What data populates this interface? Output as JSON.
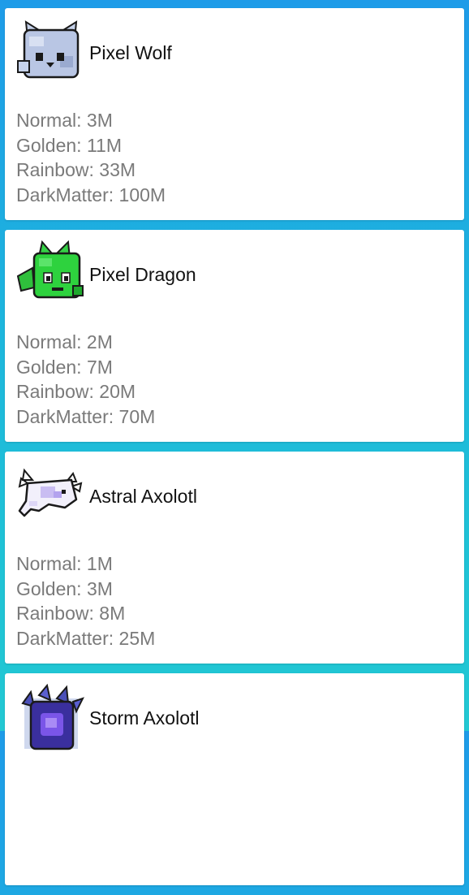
{
  "pets": [
    {
      "name": "Pixel Wolf",
      "icon": "pixel-wolf-icon",
      "stats": [
        {
          "label": "Normal",
          "value": "3M"
        },
        {
          "label": "Golden",
          "value": "11M"
        },
        {
          "label": "Rainbow",
          "value": "33M"
        },
        {
          "label": "DarkMatter",
          "value": "100M"
        }
      ]
    },
    {
      "name": "Pixel Dragon",
      "icon": "pixel-dragon-icon",
      "stats": [
        {
          "label": "Normal",
          "value": "2M"
        },
        {
          "label": "Golden",
          "value": "7M"
        },
        {
          "label": "Rainbow",
          "value": "20M"
        },
        {
          "label": "DarkMatter",
          "value": "70M"
        }
      ]
    },
    {
      "name": "Astral Axolotl",
      "icon": "astral-axolotl-icon",
      "stats": [
        {
          "label": "Normal",
          "value": "1M"
        },
        {
          "label": "Golden",
          "value": "3M"
        },
        {
          "label": "Rainbow",
          "value": "8M"
        },
        {
          "label": "DarkMatter",
          "value": "25M"
        }
      ]
    },
    {
      "name": "Storm Axolotl",
      "icon": "storm-axolotl-icon",
      "stats": []
    }
  ],
  "colors": {
    "background_top": "#1e9be8",
    "background_bottom": "#22c8d3",
    "card": "#ffffff",
    "name_text": "#111111",
    "stat_text": "#7a7a7a"
  }
}
